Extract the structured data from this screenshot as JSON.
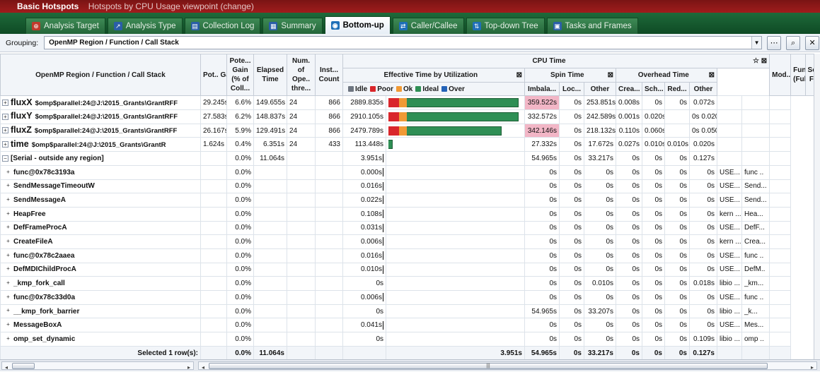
{
  "window": {
    "title": "Basic Hotspots",
    "subtitle": "Hotspots by CPU Usage viewpoint (change)"
  },
  "tabs": [
    {
      "label": "Analysis Target",
      "icon": "target-icon"
    },
    {
      "label": "Analysis Type",
      "icon": "analysis-type-icon"
    },
    {
      "label": "Collection Log",
      "icon": "collection-log-icon"
    },
    {
      "label": "Summary",
      "icon": "summary-icon"
    },
    {
      "label": "Bottom-up",
      "icon": "bottom-up-icon"
    },
    {
      "label": "Caller/Callee",
      "icon": "caller-callee-icon"
    },
    {
      "label": "Top-down Tree",
      "icon": "top-down-tree-icon"
    },
    {
      "label": "Tasks and Frames",
      "icon": "tasks-frames-icon"
    }
  ],
  "active_tab": "Bottom-up",
  "grouping": {
    "label": "Grouping:",
    "value": "OpenMP Region / Function / Call Stack"
  },
  "columns": {
    "name": "OpenMP Region / Function / Call Stack",
    "pot_gain": "Pot.. Gain",
    "pot_gain_pct": "Pote... Gain (% of Coll...",
    "elapsed": "Elapsed Time",
    "num_threads": "Num. of Ope.. thre...",
    "inst_count": "Inst... Count",
    "cpu_time": "CPU Time",
    "effective": "Effective Time by Utilization",
    "spin": "Spin Time",
    "overhead": "Overhead Time",
    "imbalance": "Imbala...",
    "lock": "Loc...",
    "spin_other": "Other",
    "creation": "Crea...",
    "scheduling": "Sch...",
    "reduction": "Red...",
    "ovh_other": "Other",
    "module": "Mod...",
    "function_full": "Fun... (Full)",
    "source_file": "Sou Fi"
  },
  "legend": [
    {
      "label": "Idle",
      "color": "#6d7580"
    },
    {
      "label": "Poor",
      "color": "#d9262b"
    },
    {
      "label": "Ok",
      "color": "#f19a35"
    },
    {
      "label": "Ideal",
      "color": "#2f8f55"
    },
    {
      "label": "Over",
      "color": "#2563b8"
    }
  ],
  "rows": [
    {
      "name": "fluxX",
      "path": "$omp$parallel:24@J:\\2015_Grants\\GrantRFF",
      "pot_gain": "29.245s",
      "pot_gain_pct": "6.6%",
      "elapsed": "149.655s",
      "threads": "24",
      "inst": "866",
      "eff": "2889.835s",
      "poor": 0.08,
      "ok": 0.06,
      "ideal": 0.86,
      "imb": "359.522s",
      "imb_hi": true,
      "lock": "0s",
      "spin_other": "253.851s",
      "crea": "0.008s",
      "sch": "0s",
      "red": "0s",
      "ovh_other": "0.072s",
      "mod": "",
      "fun": ""
    },
    {
      "name": "fluxY",
      "path": "$omp$parallel:24@J:\\2015_Grants\\GrantRFF",
      "pot_gain": "27.583s",
      "pot_gain_pct": "6.2%",
      "elapsed": "148.837s",
      "threads": "24",
      "inst": "866",
      "eff": "2910.105s",
      "poor": 0.08,
      "ok": 0.06,
      "ideal": 0.86,
      "imb": "332.572s",
      "imb_hi": false,
      "lock": "0s",
      "spin_other": "242.589s",
      "crea": "0.001s",
      "sch": "0.020s",
      "red": "",
      "ovh_other": "0s 0.020s",
      "mod": "",
      "fun": ""
    },
    {
      "name": "fluxZ",
      "path": "$omp$parallel:24@J:\\2015_Grants\\GrantRFF",
      "pot_gain": "26.167s",
      "pot_gain_pct": "5.9%",
      "elapsed": "129.491s",
      "threads": "24",
      "inst": "866",
      "eff": "2479.789s",
      "poor": 0.08,
      "ok": 0.06,
      "ideal": 0.73,
      "imb": "342.146s",
      "imb_hi": true,
      "lock": "0s",
      "spin_other": "218.132s",
      "crea": "0.110s",
      "sch": "0.060s",
      "red": "",
      "ovh_other": "0s 0.050s",
      "mod": "",
      "fun": ""
    },
    {
      "name": "time",
      "path": "$omp$parallel:24@J:\\2015_Grants\\GrantR",
      "pot_gain": "1.624s",
      "pot_gain_pct": "0.4%",
      "elapsed": "6.351s",
      "threads": "24",
      "inst": "433",
      "eff": "113.448s",
      "poor": 0,
      "ok": 0,
      "ideal": 0.03,
      "imb": "27.332s",
      "imb_hi": false,
      "lock": "0s",
      "spin_other": "17.672s",
      "crea": "0.027s",
      "sch": "0.010s",
      "red": "0.010s",
      "ovh_other": "0.020s",
      "mod": "",
      "fun": ""
    }
  ],
  "serial": {
    "name": "[Serial - outside any region]",
    "pot_gain_pct": "0.0%",
    "elapsed": "11.064s",
    "eff": "3.951s",
    "imb": "54.965s",
    "lock": "0s",
    "spin_other": "33.217s",
    "crea": "0s",
    "sch": "0s",
    "red": "0s",
    "ovh_other": "0.127s"
  },
  "functions": [
    {
      "name": "func@0x78c3193a",
      "pct": "0.0%",
      "eff": "0.000s",
      "imb": "0s",
      "lock": "0s",
      "spin_other": "0s",
      "crea": "0s",
      "sch": "0s",
      "red": "0s",
      "ovh_other": "0s",
      "mod": "USE...",
      "fun": "func .."
    },
    {
      "name": "SendMessageTimeoutW",
      "pct": "0.0%",
      "eff": "0.016s",
      "imb": "0s",
      "lock": "0s",
      "spin_other": "0s",
      "crea": "0s",
      "sch": "0s",
      "red": "0s",
      "ovh_other": "0s",
      "mod": "USE...",
      "fun": "Send..."
    },
    {
      "name": "SendMessageA",
      "pct": "0.0%",
      "eff": "0.022s",
      "imb": "0s",
      "lock": "0s",
      "spin_other": "0s",
      "crea": "0s",
      "sch": "0s",
      "red": "0s",
      "ovh_other": "0s",
      "mod": "USE...",
      "fun": "Send..."
    },
    {
      "name": "HeapFree",
      "pct": "0.0%",
      "eff": "0.108s",
      "imb": "0s",
      "lock": "0s",
      "spin_other": "0s",
      "crea": "0s",
      "sch": "0s",
      "red": "0s",
      "ovh_other": "0s",
      "mod": "kern ...",
      "fun": "Hea..."
    },
    {
      "name": "DefFrameProcA",
      "pct": "0.0%",
      "eff": "0.031s",
      "imb": "0s",
      "lock": "0s",
      "spin_other": "0s",
      "crea": "0s",
      "sch": "0s",
      "red": "0s",
      "ovh_other": "0s",
      "mod": "USE...",
      "fun": "DefF..."
    },
    {
      "name": "CreateFileA",
      "pct": "0.0%",
      "eff": "0.006s",
      "imb": "0s",
      "lock": "0s",
      "spin_other": "0s",
      "crea": "0s",
      "sch": "0s",
      "red": "0s",
      "ovh_other": "0s",
      "mod": "kern ...",
      "fun": "Crea..."
    },
    {
      "name": "func@0x78c2aaea",
      "pct": "0.0%",
      "eff": "0.016s",
      "imb": "0s",
      "lock": "0s",
      "spin_other": "0s",
      "crea": "0s",
      "sch": "0s",
      "red": "0s",
      "ovh_other": "0s",
      "mod": "USE...",
      "fun": "func .."
    },
    {
      "name": "DefMDIChildProcA",
      "pct": "0.0%",
      "eff": "0.010s",
      "imb": "0s",
      "lock": "0s",
      "spin_other": "0s",
      "crea": "0s",
      "sch": "0s",
      "red": "0s",
      "ovh_other": "0s",
      "mod": "USE...",
      "fun": "DefM.."
    },
    {
      "name": "_kmp_fork_call",
      "pct": "0.0%",
      "eff": "0s",
      "imb": "0s",
      "lock": "0s",
      "spin_other": "0.010s",
      "crea": "0s",
      "sch": "0s",
      "red": "0s",
      "ovh_other": "0.018s",
      "mod": "libio ...",
      "fun": "_km..."
    },
    {
      "name": "func@0x78c33d0a",
      "pct": "0.0%",
      "eff": "0.006s",
      "imb": "0s",
      "lock": "0s",
      "spin_other": "0s",
      "crea": "0s",
      "sch": "0s",
      "red": "0s",
      "ovh_other": "0s",
      "mod": "USE...",
      "fun": "func .."
    },
    {
      "name": "__kmp_fork_barrier",
      "pct": "0.0%",
      "eff": "0s",
      "imb": "54.965s",
      "lock": "0s",
      "spin_other": "33.207s",
      "crea": "0s",
      "sch": "0s",
      "red": "0s",
      "ovh_other": "0s",
      "mod": "libio ...",
      "fun": "_k..."
    },
    {
      "name": "MessageBoxA",
      "pct": "0.0%",
      "eff": "0.041s",
      "imb": "0s",
      "lock": "0s",
      "spin_other": "0s",
      "crea": "0s",
      "sch": "0s",
      "red": "0s",
      "ovh_other": "0s",
      "mod": "USE...",
      "fun": "Mes..."
    },
    {
      "name": "omp_set_dynamic",
      "pct": "0.0%",
      "eff": "0s",
      "imb": "0s",
      "lock": "0s",
      "spin_other": "0s",
      "crea": "0s",
      "sch": "0s",
      "red": "0s",
      "ovh_other": "0.109s",
      "mod": "libio ...",
      "fun": "omp .."
    }
  ],
  "footer": {
    "label": "Selected 1 row(s):",
    "pot_gain_pct": "0.0%",
    "elapsed": "11.064s",
    "eff": "3.951s",
    "imb": "54.965s",
    "lock": "0s",
    "spin_other": "33.217s",
    "crea": "0s",
    "sch": "0s",
    "red": "0s",
    "ovh_other": "0.127s"
  }
}
